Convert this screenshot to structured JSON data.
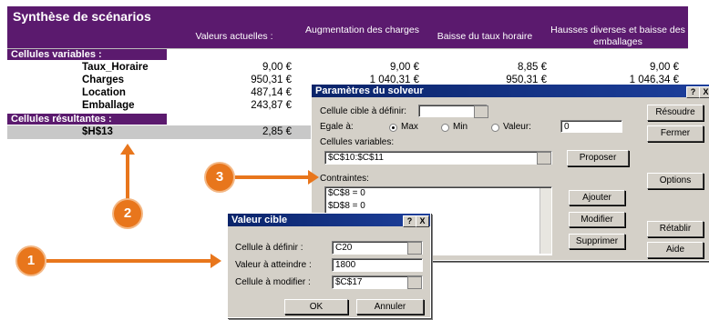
{
  "sheet": {
    "title": "Synthèse de scénarios",
    "columns": [
      "Valeurs actuelles :",
      "Augmentation des charges",
      "Baisse du taux horaire",
      "Hausses diverses et baisse des emballages"
    ],
    "variables_label": "Cellules variables :",
    "rows": [
      {
        "label": "Taux_Horaire",
        "values": [
          "9,00 €",
          "9,00 €",
          "8,85 €",
          "9,00 €"
        ]
      },
      {
        "label": "Charges",
        "values": [
          "950,31 €",
          "1 040,31 €",
          "950,31 €",
          "1 046,34 €"
        ]
      },
      {
        "label": "Location",
        "values": [
          "487,14 €"
        ]
      },
      {
        "label": "Emballage",
        "values": [
          "243,87 €"
        ]
      }
    ],
    "results_label": "Cellules résultantes :",
    "result_row": {
      "label": "$H$13",
      "value": "2,85 €"
    }
  },
  "solver": {
    "title": "Paramètres du solveur",
    "target_label": "Cellule cible à définir:",
    "target_value": "",
    "equal_label": "Egale à:",
    "max_label": "Max",
    "min_label": "Min",
    "value_label": "Valeur:",
    "value_field": "0",
    "variable_cells_label": "Cellules variables:",
    "variable_cells_value": "$C$10:$C$11",
    "propose_label": "Proposer",
    "constraints_label": "Contraintes:",
    "constraints": [
      "$C$8 = 0",
      "$D$8 = 0"
    ],
    "add_label": "Ajouter",
    "modify_label": "Modifier",
    "delete_label": "Supprimer",
    "solve_label": "Résoudre",
    "close_label": "Fermer",
    "options_label": "Options",
    "reset_label": "Rétablir",
    "help_label": "Aide",
    "help_btn": "?",
    "close_btn": "X"
  },
  "goalseek": {
    "title": "Valeur cible",
    "set_cell_label": "Cellule à définir :",
    "set_cell_value": "C20",
    "to_value_label": "Valeur à atteindre :",
    "to_value_value": "1800",
    "change_cell_label": "Cellule à modifier :",
    "change_cell_value": "$C$17",
    "ok_label": "OK",
    "cancel_label": "Annuler",
    "help_btn": "?",
    "close_btn": "X"
  },
  "callouts": [
    "1",
    "2",
    "3"
  ],
  "colors": {
    "header": "#5b1a6e",
    "callout": "#e8761c",
    "titlebar": "#0a246a"
  }
}
